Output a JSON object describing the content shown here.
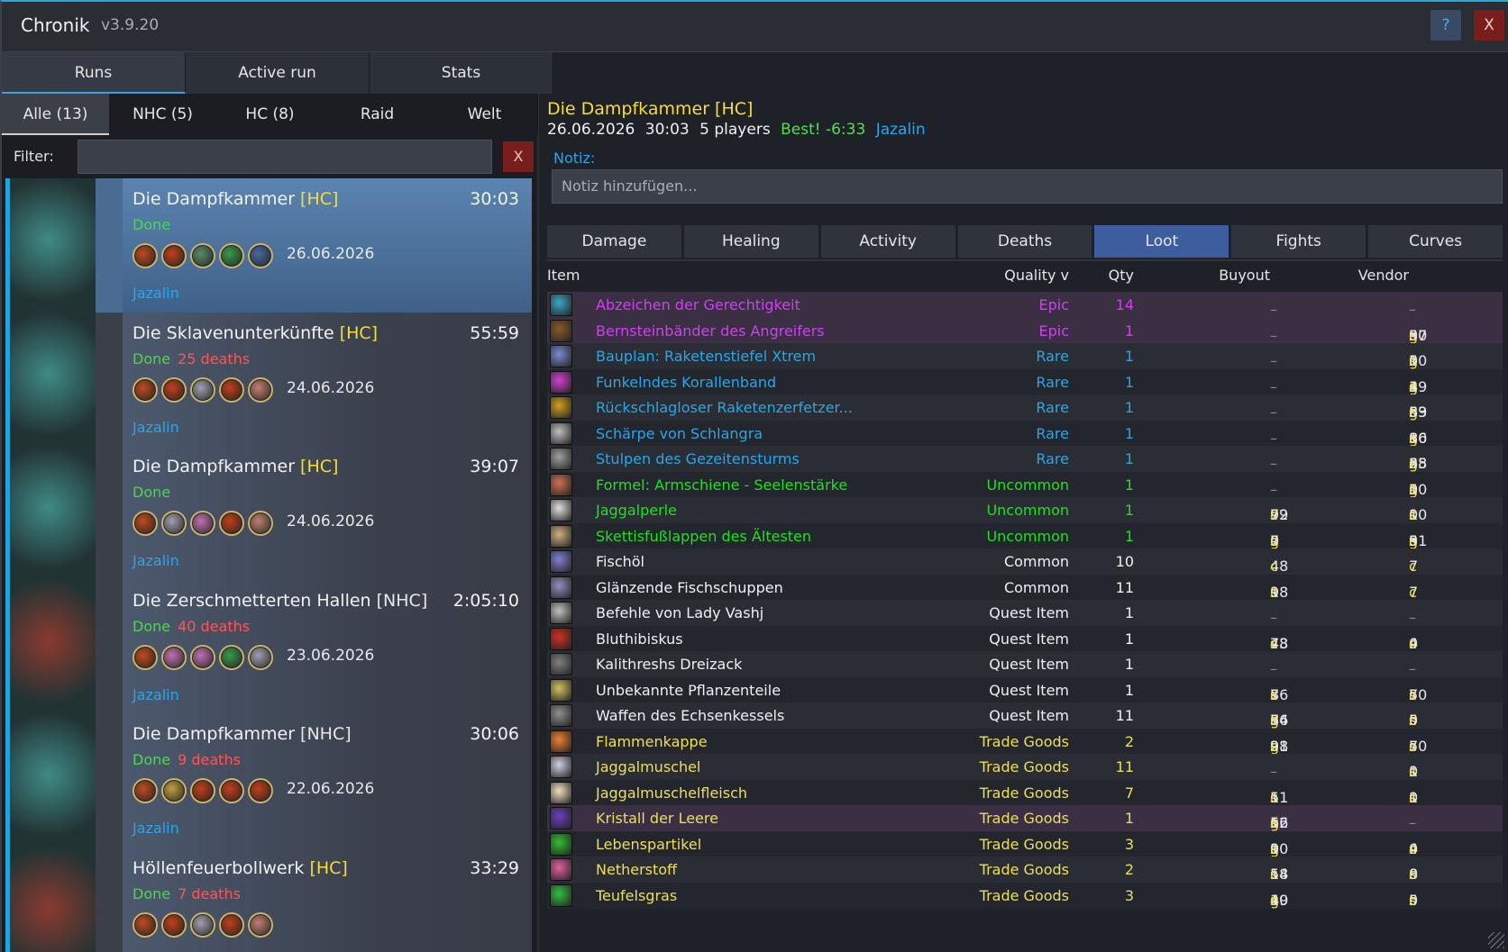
{
  "titlebar": {
    "title": "Chronik",
    "version": "v3.9.20",
    "help": "?",
    "close": "X"
  },
  "main_tabs": [
    "Runs",
    "Active run",
    "Stats"
  ],
  "sub_tabs": [
    "Alle (13)",
    "NHC (5)",
    "HC (8)",
    "Raid",
    "Welt"
  ],
  "filter": {
    "label": "Filter:",
    "value": "",
    "clear": "X"
  },
  "runs": [
    {
      "name": "Die Dampfkammer",
      "diff": "[HC]",
      "time": "30:03",
      "status": "Done",
      "deaths": "",
      "date": "26.06.2026",
      "player": "Jazalin",
      "active": true
    },
    {
      "name": "Die Sklavenunterkünfte",
      "diff": "[HC]",
      "time": "55:59",
      "status": "Done",
      "deaths": "25 deaths",
      "date": "24.06.2026",
      "player": "Jazalin"
    },
    {
      "name": "Die Dampfkammer",
      "diff": "[HC]",
      "time": "39:07",
      "status": "Done",
      "deaths": "",
      "date": "24.06.2026",
      "player": "Jazalin"
    },
    {
      "name": "Die Zerschmetterten Hallen",
      "diff": "[NHC]",
      "time": "2:05:10",
      "status": "Done",
      "deaths": "40 deaths",
      "date": "23.06.2026",
      "player": "Jazalin"
    },
    {
      "name": "Die Dampfkammer",
      "diff": "[NHC]",
      "time": "30:06",
      "status": "Done",
      "deaths": "9 deaths",
      "date": "22.06.2026",
      "player": "Jazalin"
    },
    {
      "name": "Höllenfeuerbollwerk",
      "diff": "[HC]",
      "time": "33:29",
      "status": "Done",
      "deaths": "7 deaths",
      "date": "",
      "player": ""
    }
  ],
  "detail": {
    "title": "Die Dampfkammer  [HC]",
    "date": "26.06.2026",
    "duration": "30:03",
    "players": "5 players",
    "best": "Best! -6:33",
    "player": "Jazalin",
    "note_label": "Notiz:",
    "note_placeholder": "Notiz hinzufügen..."
  },
  "detail_tabs": [
    "Damage",
    "Healing",
    "Activity",
    "Deaths",
    "Loot",
    "Fights",
    "Curves"
  ],
  "table_headers": {
    "item": "Item",
    "quality": "Quality v",
    "qty": "Qty",
    "buyout": "Buyout",
    "vendor": "Vendor"
  },
  "loot": [
    {
      "name": "Abzeichen der Gerechtigkeit",
      "quality": "Epic",
      "qty": "14",
      "buyout": "–",
      "vendor": "–"
    },
    {
      "name": "Bernsteinbänder des Angreifers",
      "quality": "Epic",
      "qty": "1",
      "buyout": "–",
      "vendor": "3g 97s 50c"
    },
    {
      "name": "Bauplan: Raketenstiefel Xtrem",
      "quality": "Rare",
      "qty": "1",
      "buyout": "–",
      "vendor": "1g 50s 0c"
    },
    {
      "name": "Funkelndes Korallenband",
      "quality": "Rare",
      "qty": "1",
      "buyout": "–",
      "vendor": "4g 19s 3c"
    },
    {
      "name": "Rückschlagloser Raketenzerfetzer...",
      "quality": "Rare",
      "qty": "1",
      "buyout": "–",
      "vendor": "6g 59s 83c"
    },
    {
      "name": "Schärpe von Schlangra",
      "quality": "Rare",
      "qty": "1",
      "buyout": "–",
      "vendor": "1g 80s 86c"
    },
    {
      "name": "Stulpen des Gezeitensturms",
      "quality": "Rare",
      "qty": "1",
      "buyout": "–",
      "vendor": "2g 65s 38c"
    },
    {
      "name": "Formel: Armschiene - Seelenstärke",
      "quality": "Uncommon",
      "qty": "1",
      "buyout": "–",
      "vendor": "1g 50s 0c"
    },
    {
      "name": "Jaggalperle",
      "quality": "Uncommon",
      "qty": "1",
      "buyout": "72s 99c",
      "vendor": "10s 0c"
    },
    {
      "name": "Skettisfußlappen des Ältesten",
      "quality": "Uncommon",
      "qty": "1",
      "buyout": "7g 0s 0c",
      "vendor": "3g 9s 51c"
    },
    {
      "name": "Fischöl",
      "quality": "Common",
      "qty": "10",
      "buyout": "48c",
      "vendor": "7c"
    },
    {
      "name": "Glänzende Fischschuppen",
      "quality": "Common",
      "qty": "11",
      "buyout": "1s 98c",
      "vendor": "7c"
    },
    {
      "name": "Befehle von Lady Vashj",
      "quality": "Quest Item",
      "qty": "1",
      "buyout": "–",
      "vendor": "–"
    },
    {
      "name": "Bluthibiskus",
      "quality": "Quest Item",
      "qty": "1",
      "buyout": "48s 73c",
      "vendor": "4s 0c"
    },
    {
      "name": "Kalithreshs Dreizack",
      "quality": "Quest Item",
      "qty": "1",
      "buyout": "–",
      "vendor": "–"
    },
    {
      "name": "Unbekannte Pflanzenteile",
      "quality": "Quest Item",
      "qty": "1",
      "buyout": "8s 76c",
      "vendor": "7s 50c"
    },
    {
      "name": "Waffen des Echsenkessels",
      "quality": "Quest Item",
      "qty": "11",
      "buyout": "3g 74s 86c",
      "vendor": "5s 0c"
    },
    {
      "name": "Flammenkappe",
      "quality": "Trade Goods",
      "qty": "2",
      "buyout": "2g 98s 91c",
      "vendor": "7s 50c"
    },
    {
      "name": "Jaggalmuschel",
      "quality": "Trade Goods",
      "qty": "11",
      "buyout": "–",
      "vendor": "1s 0c"
    },
    {
      "name": "Jaggalmuschelfleisch",
      "quality": "Trade Goods",
      "qty": "7",
      "buyout": "1s 51c",
      "vendor": "1s 0c"
    },
    {
      "name": "Kristall der Leere",
      "quality": "Trade Goods",
      "qty": "1",
      "buyout": "5g 16s 62c",
      "vendor": "–"
    },
    {
      "name": "Lebenspartikel",
      "quality": "Trade Goods",
      "qty": "3",
      "buyout": "1g 0s 90c",
      "vendor": "4s 0c"
    },
    {
      "name": "Netherstoff",
      "quality": "Trade Goods",
      "qty": "2",
      "buyout": "14s 58c",
      "vendor": "8s 0c"
    },
    {
      "name": "Teufelsgras",
      "quality": "Trade Goods",
      "qty": "3",
      "buyout": "1g 40s 49c",
      "vendor": "5s 0c"
    }
  ],
  "colors": {
    "accent": "#2aa8d8",
    "epic": "#d040f0",
    "rare": "#2aa6e8",
    "uncommon": "#20e020",
    "gold": "#f7dd3a",
    "deaths": "#ff5555"
  }
}
